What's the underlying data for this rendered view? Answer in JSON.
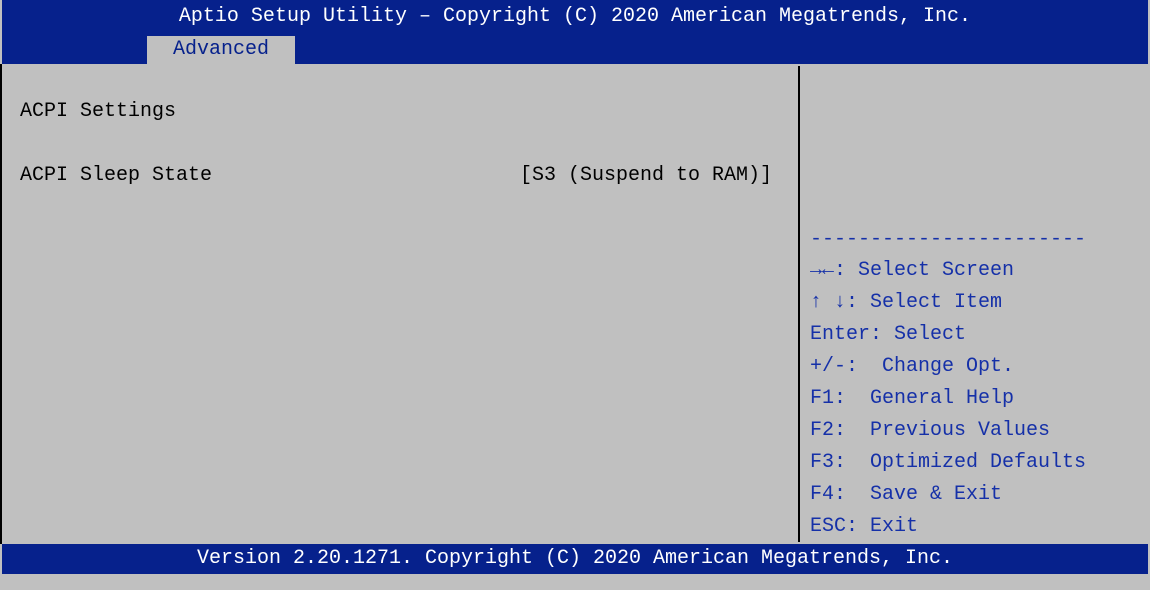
{
  "title": "Aptio Setup Utility – Copyright (C) 2020 American Megatrends, Inc.",
  "tabs": [
    {
      "label": "Advanced",
      "active": true
    }
  ],
  "main": {
    "section_heading": "ACPI Settings",
    "options": [
      {
        "label": "ACPI Sleep State",
        "value": "[S3 (Suspend to RAM)]"
      }
    ]
  },
  "help": {
    "separator": "-----------------------",
    "keys": [
      {
        "key": "→←",
        "desc": ": Select Screen"
      },
      {
        "key": "↑ ↓",
        "desc": ": Select Item"
      },
      {
        "key": "Enter",
        "desc": ": Select"
      },
      {
        "key": "+/-",
        "desc": ":  Change Opt."
      },
      {
        "key": "F1",
        "desc": ":  General Help"
      },
      {
        "key": "F2",
        "desc": ":  Previous Values"
      },
      {
        "key": "F3",
        "desc": ":  Optimized Defaults"
      },
      {
        "key": "F4",
        "desc": ":  Save & Exit"
      },
      {
        "key": "ESC",
        "desc": ": Exit"
      }
    ]
  },
  "footer": "Version 2.20.1271. Copyright (C) 2020 American Megatrends, Inc.",
  "colors": {
    "bar_blue": "#06218c",
    "panel_gray": "#c0c0c0",
    "help_text_blue": "#1530a8"
  }
}
